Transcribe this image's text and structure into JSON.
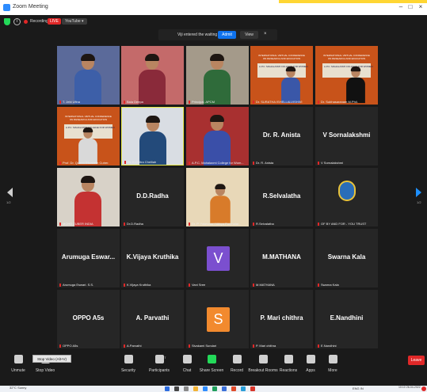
{
  "window": {
    "title": "Zoom Meeting",
    "minimize_glyph": "–",
    "maximize_glyph": "□",
    "close_glyph": "×"
  },
  "meeting_top": {
    "recording_label": "Recording",
    "live_label": "LIVE",
    "youtube_label": "YouTube ▾"
  },
  "notification": {
    "message": "Viji entered the waiting room",
    "admit_label": "Admit",
    "view_label": "View",
    "close_glyph": "×"
  },
  "poster": {
    "title": "INTERNATIONAL VIRTUAL CONFERENCE ON RESEARCH AND EDUCATION",
    "college": "A.P.C. MAHALAXMI COLLEGE FOR WOMEN"
  },
  "tiles": [
    {
      "type": "video",
      "label": "T. Jebi Ufina",
      "shirt": "#3d5fa8",
      "bg": "#5b6a9a"
    },
    {
      "type": "video",
      "label": "Bala Deepa",
      "shirt": "#8a2a3a",
      "bg": "#c46a6a"
    },
    {
      "type": "video",
      "label": "Principal, APCM",
      "shirt": "#2f6b3a",
      "bg": "#a49a8a"
    },
    {
      "type": "poster",
      "label": "Dr. SURATHA ISHELLALVISHIVI",
      "shirt": "#3a57a8",
      "bg": "#c8531a"
    },
    {
      "type": "poster",
      "label": "Dr. Subhasaranam M.Phil.",
      "shirt": "#111111",
      "bg": "#c8531a"
    },
    {
      "type": "poster",
      "label": "Prof. Dr. Queen Elizabeth Cutrer.",
      "shirt": "#d9d9d9",
      "bg": "#c8531a"
    },
    {
      "type": "video",
      "label": "Dr. K.Chitra Chelliah",
      "shirt": "#234a7a",
      "bg": "#d9dde3",
      "active": true
    },
    {
      "type": "video",
      "label": "A.P.C. Mahalaxmi College for Wom...",
      "shirt": "#3a4fa8",
      "bg": "#a83030"
    },
    {
      "type": "name",
      "name": "Dr. R. Anista",
      "label": "Dr. R. Anista"
    },
    {
      "type": "name",
      "name": "V Sornalakshmi",
      "label": "V Sornalakshmi"
    },
    {
      "type": "video",
      "label": "MOHD ZUBER INDIA",
      "shirt": "#c43232",
      "bg": "#d8d2c8"
    },
    {
      "type": "name",
      "name": "D.D.Radha",
      "label": "Dr.D.Radha"
    },
    {
      "type": "photo",
      "label": "Dr. P. Yokeswari Nithya Ponmalar...",
      "shirt": "#d87b2a",
      "bg": "#e8d8b8"
    },
    {
      "type": "name",
      "name": "R.Selvalatha",
      "label": "R.Selvalatha"
    },
    {
      "type": "logo",
      "label": "OF BY AND FOR - YOU TRUST"
    },
    {
      "type": "name",
      "name": "Arumuga  Eswar...",
      "label": "Arumuga Eswari. S.S."
    },
    {
      "type": "name",
      "name": "K.Vijaya Kruthika",
      "label": "K.Vijaya Kruthika"
    },
    {
      "type": "avatar",
      "letter": "V",
      "color": "#7b4fcf",
      "label": "Vani Sree"
    },
    {
      "type": "name",
      "name": "M.MATHANA",
      "label": "M.MATHANA"
    },
    {
      "type": "name",
      "name": "Swarna Kala",
      "label": "Swarna Kala"
    },
    {
      "type": "name",
      "name": "OPPO A5s",
      "label": "OPPO A5s"
    },
    {
      "type": "name",
      "name": "A. Parvathi",
      "label": "A.Parvathi"
    },
    {
      "type": "avatar",
      "letter": "S",
      "color": "#f28a2e",
      "label": "Sivakami Sundari"
    },
    {
      "type": "name",
      "name": "P. Mari chithra",
      "label": "P. Mari chithra"
    },
    {
      "type": "name",
      "name": "E.Nandhini",
      "label": "E.Nandhini"
    }
  ],
  "nav": {
    "left_page": "1/2",
    "right_page": "1/2"
  },
  "toolbar": {
    "unmute": "Unmute",
    "stop_video": "Stop Video",
    "security": "Security",
    "participants": "Participants",
    "participants_count": "27",
    "chat": "Chat",
    "share_screen": "Share Screen",
    "record": "Record",
    "breakout": "Breakout Rooms",
    "reactions": "Reactions",
    "apps": "Apps",
    "more": "More",
    "leave": "Leave",
    "tooltip": "Stop Video (Alt+V)"
  },
  "taskbar": {
    "weather_temp": "32°C",
    "weather_desc": "Sunny",
    "lang": "ENG IN",
    "time": "10:10",
    "date": "26-04-2022"
  }
}
